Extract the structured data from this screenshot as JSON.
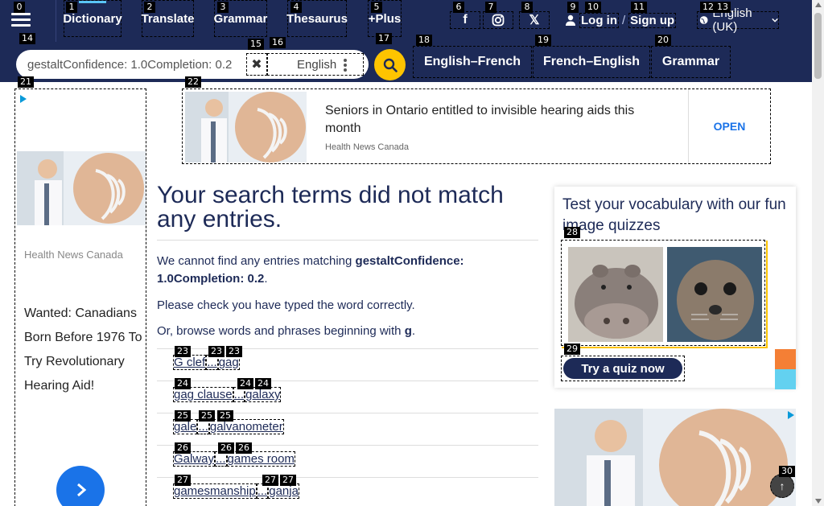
{
  "nav": {
    "menu_icon": "hamburger-icon",
    "links": [
      "Dictionary",
      "Translate",
      "Grammar",
      "Thesaurus",
      "+Plus"
    ],
    "social_icons": [
      "facebook-icon",
      "instagram-icon",
      "x-icon"
    ],
    "login": "Log in",
    "login_sep": "/",
    "signup": "Sign up",
    "language": "English (UK)",
    "accent_color": "#5ac5f5"
  },
  "search": {
    "value": "gestaltConfidence: 1.0Completion: 0.2",
    "dictionary": "English",
    "tools": [
      "English–French",
      "French–English",
      "Grammar"
    ],
    "button_color": "#fec400"
  },
  "badges": [
    "0",
    "1",
    "2",
    "3",
    "4",
    "5",
    "6",
    "7",
    "8",
    "9",
    "10",
    "11",
    "12",
    "13",
    "14",
    "15",
    "16",
    "17",
    "18",
    "19",
    "20",
    "21",
    "22",
    "23",
    "24",
    "25",
    "26",
    "27",
    "28",
    "29",
    "30"
  ],
  "ads": {
    "left": {
      "source": "Health News Canada",
      "headline": "Wanted: Canadians Born Before 1976 To Try Revolutionary Hearing Aid!"
    },
    "top": {
      "headline": "Seniors in Ontario entitled to invisible hearing aids this month",
      "source": "Health News Canada",
      "cta": "OPEN"
    }
  },
  "main": {
    "title": "Your search terms did not match any entries.",
    "cannot_find": "We cannot find any entries matching",
    "query": "gestaltConfidence: 1.0Completion: 0.2",
    "period": ".",
    "check": "Please check you have typed the word correctly.",
    "browse_prefix": "Or, browse words and phrases beginning with",
    "browse_letter": "g",
    "ranges": [
      {
        "from": "G clef",
        "sep": "...",
        "to": "gag"
      },
      {
        "from": "gag clause",
        "sep": "...",
        "to": "galaxy"
      },
      {
        "from": "gale",
        "sep": "...",
        "to": "galvanometer"
      },
      {
        "from": "Galway",
        "sep": "...",
        "to": "games room"
      },
      {
        "from": "gamesmanship",
        "sep": "...",
        "to": "ganja"
      }
    ]
  },
  "quiz": {
    "title": "Test your vocabulary with our fun image quizzes",
    "button": "Try a quiz now"
  },
  "back_to_top": "↑"
}
